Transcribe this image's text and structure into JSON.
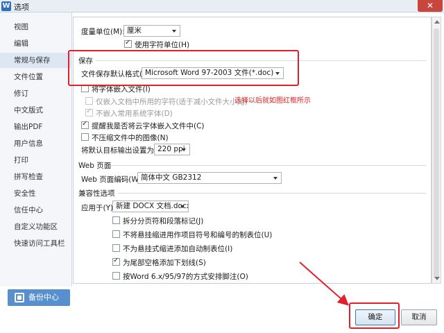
{
  "window": {
    "title": "选项",
    "app_icon_letter": "W",
    "close_symbol": "✕"
  },
  "sidebar": {
    "items": [
      {
        "label": "视图"
      },
      {
        "label": "编辑"
      },
      {
        "label": "常规与保存"
      },
      {
        "label": "文件位置"
      },
      {
        "label": "修订"
      },
      {
        "label": "中文版式"
      },
      {
        "label": "输出PDF"
      },
      {
        "label": "用户信息"
      },
      {
        "label": "打印"
      },
      {
        "label": "拼写检查"
      },
      {
        "label": "安全性"
      },
      {
        "label": "信任中心"
      },
      {
        "label": "自定义功能区"
      },
      {
        "label": "快速访问工具栏"
      }
    ],
    "active_index": 2,
    "backup_button": "备份中心"
  },
  "general": {
    "measure_unit_label": "度量单位(M):",
    "measure_unit_value": "厘米",
    "use_char_unit_label": "使用字符单位(H)",
    "use_char_unit_checked": true
  },
  "save": {
    "section_title": "保存",
    "default_format_label": "文件保存默认格式(F):",
    "default_format_value": "Microsoft Word 97-2003 文件(*.doc)",
    "embed_fonts_label": "将字体嵌入文件(I)",
    "embed_fonts_checked": false,
    "embed_used_chars_label": "仅嵌入文档中所用的字符(适于减小文件大小)(J)",
    "embed_used_chars_checked": false,
    "no_system_fonts_label": "不嵌入常用系统字体(D)",
    "no_system_fonts_checked": true,
    "remind_cloud_fonts_label": "提醒我是否将云字体嵌入文件中(C)",
    "remind_cloud_fonts_checked": true,
    "no_compress_images_label": "不压缩文件中的图像(N)",
    "no_compress_images_checked": false,
    "default_output_label": "将默认目标输出设置为(P):",
    "default_output_value": "220 ppi"
  },
  "annotation": "选择以后就如图红框所示",
  "web": {
    "section_title": "Web 页面",
    "encoding_label": "Web 页面编码(W):",
    "encoding_value": "简体中文 GB2312"
  },
  "compat": {
    "section_title": "兼容性选项",
    "apply_to_label": "应用于(Y):",
    "apply_to_value": "新建 DOCX 文档.docx",
    "options": [
      {
        "label": "拆分分页符和段落标记(J)",
        "checked": false
      },
      {
        "label": "不将悬挂缩进用作项目符号和编号的制表位(U)",
        "checked": false
      },
      {
        "label": "不为悬挂式缩进添加自动制表位(I)",
        "checked": false
      },
      {
        "label": "为尾部空格添加下划线(S)",
        "checked": true
      },
      {
        "label": "按Word 6.x/95/97的方式安排脚注(O)",
        "checked": false
      }
    ]
  },
  "footer": {
    "ok_label": "确定",
    "cancel_label": "取消"
  },
  "colors": {
    "annotation_red": "#e0202a",
    "accent_blue": "#5890cf"
  }
}
